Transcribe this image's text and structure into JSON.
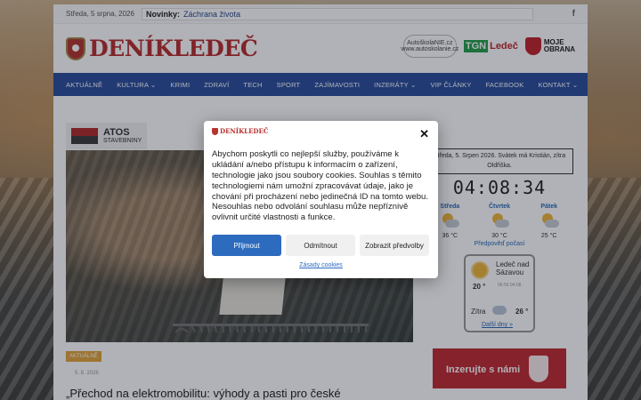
{
  "topbar": {
    "date": "Středa, 5 srpna, 2026",
    "novinky_label": "Novinky:",
    "novinky_text": "Záchrana života",
    "social_icon": "facebook-icon"
  },
  "header": {
    "logo_text": "DENÍKLEDEČ",
    "sponsor1_name": "AutoškolaNIE.cz",
    "sponsor1_url": "www.autoskolanie.cz",
    "sponsor2_tag": "TGN",
    "sponsor2_name": "Ledeč",
    "sponsor3_line1": "MOJE",
    "sponsor3_line2": "OBRANA"
  },
  "nav": {
    "items": [
      "AKTUÁLNĚ",
      "KULTURA ⌄",
      "KRIMI",
      "ZDRAVÍ",
      "TECH",
      "SPORT",
      "ZAJÍMAVOSTI",
      "INZERÁTY ⌄",
      "VIP ČLÁNKY",
      "FACEBOOK",
      "KONTAKT ⌄"
    ]
  },
  "main": {
    "ad_name": "ATOS",
    "ad_sub": "STAVEBNINY",
    "tag": "AKTUÁLNĚ",
    "meta": "5. 8. 2026",
    "title": "„Přechod na elektromobilitu: výhody a pasti pro české"
  },
  "sidebar": {
    "date_line1": "Středa, 5. Srpen 2026. Svátek má Kristián, zítra",
    "date_line2": "Oldřiška.",
    "clock": "04:08:34",
    "days": [
      {
        "name": "Středa",
        "temp": "36 °C",
        "icon": "partly-cloudy-icon"
      },
      {
        "name": "Čtvrtek",
        "temp": "30 °C",
        "icon": "partly-cloudy-icon"
      },
      {
        "name": "Pátek",
        "temp": "25 °C",
        "icon": "partly-cloudy-icon"
      }
    ],
    "forecast_link": "Předpověď počasí",
    "card": {
      "location": "Ledeč nad Sázavou",
      "temp_today": "20 °",
      "small": "06:56 04:08",
      "zitra": "Zítra",
      "temp_tomorrow": "26 °",
      "more": "Další dny »"
    },
    "ad_text": "Inzerujte s námi"
  },
  "modal": {
    "logo": "DENÍKLEDEČ",
    "close": "✕",
    "text": "Abychom poskytli co nejlepší služby, používáme k ukládání a/nebo přístupu k informacím o zařízení, technologie jako jsou soubory cookies. Souhlas s těmito technologiemi nám umožní zpracovávat údaje, jako je chování při procházení nebo jedinečná ID na tomto webu. Nesouhlas nebo odvolání souhlasu může nepříznivě ovlivnit určité vlastnosti a funkce.",
    "accept": "Přijmout",
    "deny": "Odmítnout",
    "prefs": "Zobrazit předvolby",
    "policy": "Zásady cookies"
  },
  "colors": {
    "nav": "#2d4f9c",
    "brand_red": "#b92f2f",
    "accept": "#2d6bbf"
  }
}
